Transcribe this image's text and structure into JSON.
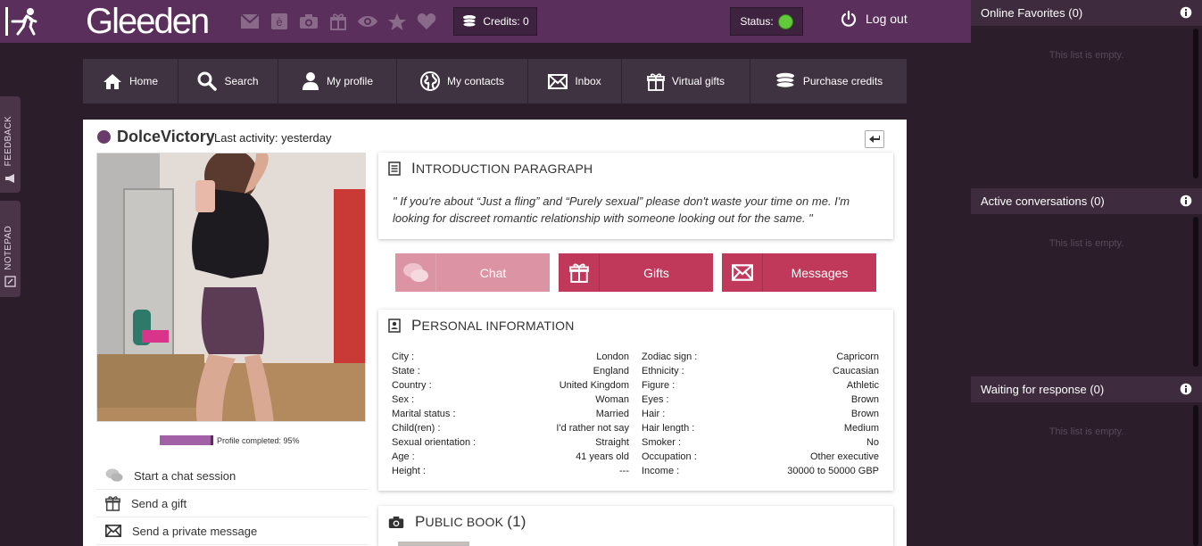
{
  "header": {
    "logo_text": "Gleeden",
    "credits_label": "Credits: 0",
    "status_label": "Status:",
    "logout_label": "Log out",
    "icons": [
      "envelope-icon",
      "letter-e-icon",
      "camera-icon",
      "gift-icon",
      "eye-icon",
      "star-icon",
      "heart-icon"
    ]
  },
  "side_tabs": {
    "feedback": "FEEDBACK",
    "notepad": "NOTEPAD"
  },
  "nav": [
    {
      "label": "Home",
      "icon": "home-icon"
    },
    {
      "label": "Search",
      "icon": "search-icon"
    },
    {
      "label": "My profile",
      "icon": "user-icon"
    },
    {
      "label": "My contacts",
      "icon": "globe-icon"
    },
    {
      "label": "Inbox",
      "icon": "envelope-icon"
    },
    {
      "label": "Virtual gifts",
      "icon": "gift-icon"
    },
    {
      "label": "Purchase credits",
      "icon": "coins-icon"
    }
  ],
  "profile": {
    "username": "DolceVictory",
    "last_activity": "Last activity:  yesterday",
    "progress_label": "Profile completed: 95%",
    "progress_value": 0.95,
    "actions": [
      {
        "label": "Start a chat session",
        "icon": "chat-icon"
      },
      {
        "label": "Send a gift",
        "icon": "gift-icon"
      },
      {
        "label": "Send a private message",
        "icon": "envelope-icon"
      }
    ]
  },
  "intro": {
    "title_initial": "I",
    "title_rest": "NTRODUCTION PARAGRAPH",
    "text": "\" If you're about “Just a fling” and “Purely sexual” please don't waste your time on me. I'm looking for discreet romantic relationship with someone looking out for the same. \""
  },
  "buttons": {
    "chat": "Chat",
    "gifts": "Gifts",
    "messages": "Messages"
  },
  "personal": {
    "title_initial": "P",
    "title_rest": "ERSONAL INFORMATION",
    "left": [
      {
        "label": "City :",
        "value": "London"
      },
      {
        "label": "State :",
        "value": "England"
      },
      {
        "label": "Country :",
        "value": "United Kingdom"
      },
      {
        "label": "Sex :",
        "value": "Woman"
      },
      {
        "label": "Marital status :",
        "value": "Married"
      },
      {
        "label": "Child(ren) :",
        "value": "I'd rather not say"
      },
      {
        "label": "Sexual orientation :",
        "value": "Straight"
      },
      {
        "label": "Age :",
        "value": "41 years old"
      },
      {
        "label": "Height :",
        "value": "---"
      }
    ],
    "right": [
      {
        "label": "Zodiac sign :",
        "value": "Capricorn"
      },
      {
        "label": "Ethnicity :",
        "value": "Caucasian"
      },
      {
        "label": "Figure :",
        "value": "Athletic"
      },
      {
        "label": "Eyes :",
        "value": "Brown"
      },
      {
        "label": "Hair :",
        "value": "Brown"
      },
      {
        "label": "Hair length :",
        "value": "Medium"
      },
      {
        "label": "Smoker :",
        "value": "No"
      },
      {
        "label": "Occupation :",
        "value": "Other executive"
      },
      {
        "label": "Income :",
        "value": "30000 to 50000 GBP"
      }
    ]
  },
  "public_book": {
    "title_initial": "P",
    "title_rest": "UBLIC BOOK",
    "count": "(1)"
  },
  "sidebar": {
    "online_favorites": "Online Favorites (0)",
    "active_conversations": "Active conversations (0)",
    "waiting_response": "Waiting for response (0)",
    "empty_text": "This list is empty."
  },
  "colors": {
    "header_bg": "#5a2f5b",
    "accent": "#c0385a",
    "chat_btn": "#dc93a4",
    "status_online": "#61c93a"
  }
}
